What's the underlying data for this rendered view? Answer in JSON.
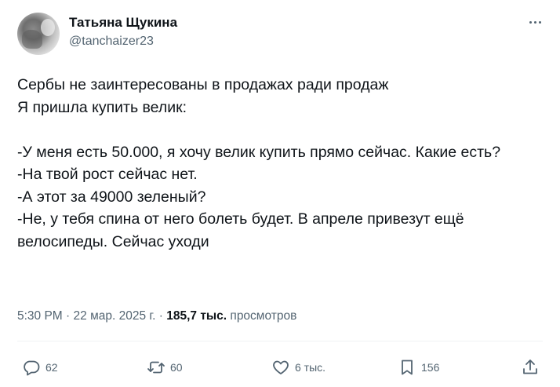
{
  "author": {
    "display_name": "Татьяна Щукина",
    "handle": "@tanchaizer23"
  },
  "tweet": {
    "lines": [
      "Сербы не заинтересованы в продажах ради продаж",
      "Я пришла купить велик:",
      "",
      "-У меня есть 50.000, я хочу велик купить прямо сейчас. Какие есть?",
      "-На твой рост сейчас нет.",
      "-А этот за 49000 зеленый?",
      "-Не, у тебя спина от него болеть будет. В апреле привезут ещё велосипеды. Сейчас уходи"
    ]
  },
  "meta": {
    "time": "5:30 PM",
    "separator": "·",
    "date": "22 мар. 2025 г.",
    "views_count": "185,7 тыс.",
    "views_label": "просмотров"
  },
  "actions": {
    "replies": "62",
    "reposts": "60",
    "likes": "6 тыс.",
    "bookmarks": "156"
  },
  "colors": {
    "text": "#0f1419",
    "secondary": "#536471",
    "divider": "#eff3f4"
  }
}
